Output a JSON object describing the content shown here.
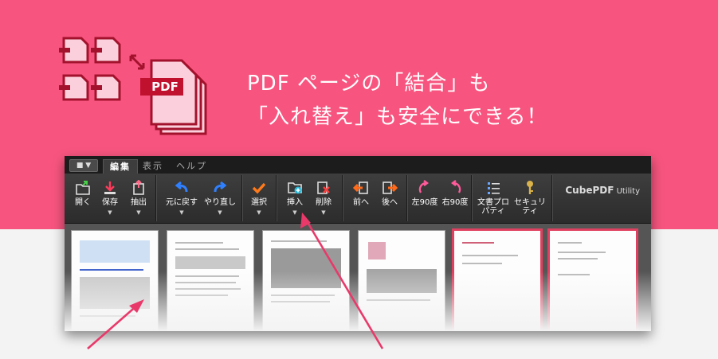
{
  "hero": {
    "headline_line1": "PDF ページの「結合」も",
    "headline_line2": "「入れ替え」も安全にできる！",
    "icon_badge": "PDF"
  },
  "app": {
    "menu_button": "▼",
    "tabs": [
      {
        "label": "編集",
        "active": true
      },
      {
        "label": "表示",
        "active": false
      },
      {
        "label": "ヘルプ",
        "active": false
      }
    ],
    "toolbar": {
      "open": "開く",
      "save": "保存",
      "extract": "抽出",
      "undo": "元に戻す",
      "redo": "やり直し",
      "select": "選択",
      "insert": "挿入",
      "delete": "削除",
      "prev": "前へ",
      "next": "後へ",
      "rotate_left": "左90度",
      "rotate_right": "右90度",
      "doc_properties_line1": "文書プロ",
      "doc_properties_line2": "パティ",
      "security_line1": "セキュリ",
      "security_line2": "ティ"
    },
    "brand_bold": "CubePDF",
    "brand_rest": " Utility"
  },
  "colors": {
    "accent_pink": "#f7557f",
    "selection_red": "#e0405f",
    "arrow_pink": "#e8396a"
  }
}
